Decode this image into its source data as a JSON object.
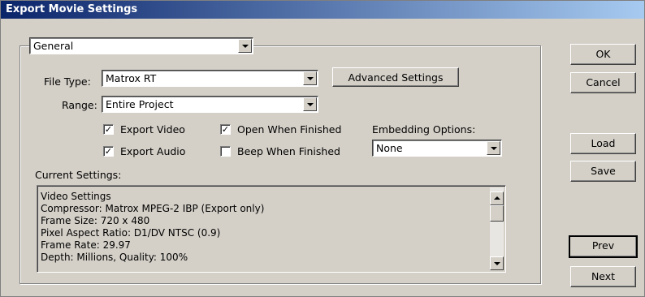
{
  "window": {
    "title": "Export Movie Settings"
  },
  "category": {
    "selected": "General"
  },
  "file_type": {
    "label": "File Type:",
    "value": "Matrox RT"
  },
  "advanced_settings": {
    "label": "Advanced Settings"
  },
  "range": {
    "label": "Range:",
    "value": "Entire Project"
  },
  "checkboxes": {
    "export_video": {
      "label": "Export Video",
      "checked": true
    },
    "export_audio": {
      "label": "Export Audio",
      "checked": true
    },
    "open_when_finished": {
      "label": "Open When Finished",
      "checked": true
    },
    "beep_when_finished": {
      "label": "Beep When Finished",
      "checked": false
    }
  },
  "embedding": {
    "label": "Embedding Options:",
    "value": "None"
  },
  "current_settings": {
    "label": "Current Settings:",
    "lines": [
      "Video Settings",
      "Compressor: Matrox MPEG-2 IBP (Export only)",
      "Frame Size: 720 x 480",
      "Pixel Aspect Ratio: D1/DV NTSC (0.9)",
      "Frame Rate: 29.97",
      "Depth: Millions, Quality: 100%"
    ]
  },
  "buttons": {
    "ok": "OK",
    "cancel": "Cancel",
    "load": "Load",
    "save": "Save",
    "prev": "Prev",
    "next": "Next"
  },
  "check_glyph": "✓"
}
